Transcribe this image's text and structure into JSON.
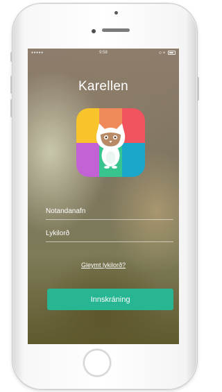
{
  "status_bar": {
    "signal": "●●●●●",
    "time": "9:58",
    "indicators": "⊙ ✈"
  },
  "app": {
    "title": "Karellen"
  },
  "form": {
    "username_label": "Notandanafn",
    "password_label": "Lykilorð",
    "forgot_link": "Gleymt lykilorð?",
    "login_button": "Innskráning"
  },
  "colors": {
    "accent": "#28b592",
    "logo_quadrants": [
      "#f7c52b",
      "#ef8a5a",
      "#f1545f",
      "#c262d5",
      "#37c48f",
      "#1aa7c9"
    ]
  },
  "icons": {
    "logo": "owl-logo-icon",
    "battery": "battery-icon"
  }
}
